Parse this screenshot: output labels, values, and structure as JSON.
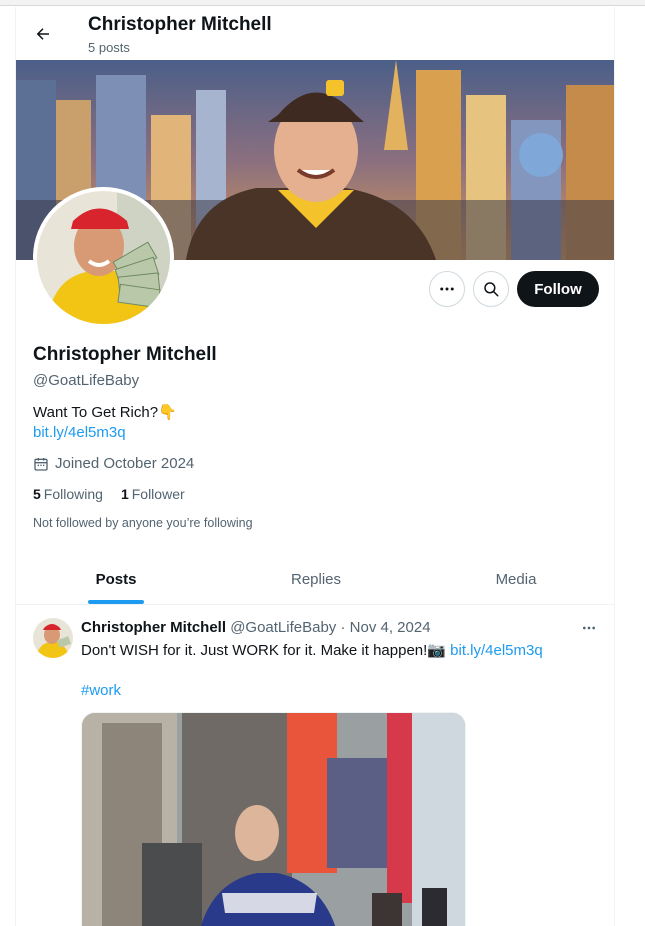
{
  "header": {
    "title": "Christopher Mitchell",
    "posts_count": "5 posts"
  },
  "profile": {
    "name": "Christopher Mitchell",
    "handle": "@GoatLifeBaby",
    "bio": "Want To Get Rich?👇",
    "link": "bit.ly/4el5m3q",
    "joined": "Joined October 2024",
    "following_count": "5",
    "following_label": "Following",
    "followers_count": "1",
    "followers_label": "Follower",
    "not_followed": "Not followed by anyone you’re following"
  },
  "actions": {
    "follow_label": "Follow"
  },
  "tabs": [
    {
      "label": "Posts",
      "active": true
    },
    {
      "label": "Replies",
      "active": false
    },
    {
      "label": "Media",
      "active": false
    }
  ],
  "post": {
    "author_name": "Christopher Mitchell",
    "author_handle": "@GoatLifeBaby",
    "separator": "·",
    "date": "Nov 4, 2024",
    "text": "Don't WISH for it. Just WORK for it. Make it happen!📷",
    "link": "bit.ly/4el5m3q",
    "hashtag": "#work"
  },
  "colors": {
    "accent": "#1d9bf0",
    "text": "#0f1419",
    "secondary": "#536471",
    "border": "#cfd9de"
  }
}
